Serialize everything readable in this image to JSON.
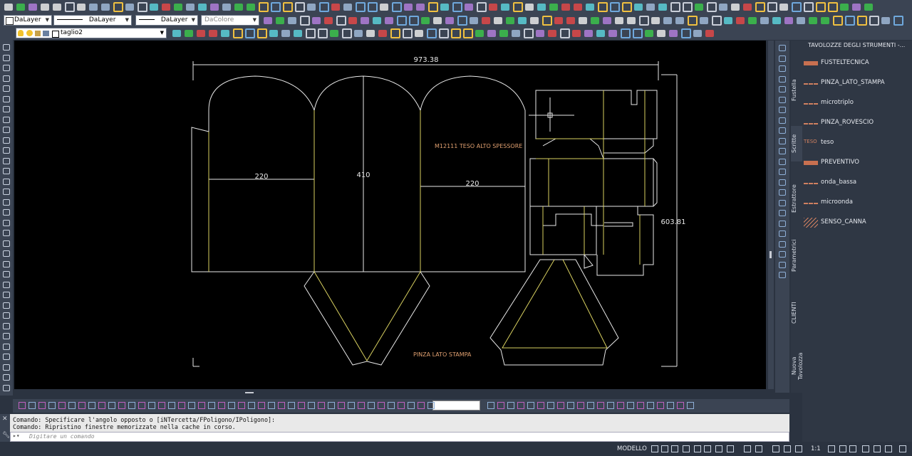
{
  "toolbar": {
    "layer_select": "DaLayer",
    "linetype_select": "DaLayer",
    "lineweight_select": "DaLayer",
    "color_select": "DaColore",
    "current_layer": "taglio2"
  },
  "drawing": {
    "dim_width": "973.38",
    "dim_height": "603.81",
    "dim_left_panel": "220",
    "dim_center_panel": "410",
    "dim_right_panel": "220",
    "label_article": "M12111 TESO ALTO SPESSORE",
    "label_pinza": "PINZA LATO STAMPA"
  },
  "palette": {
    "title": "TAVOLOZZE DEGLI STRUMENTI -...",
    "items": [
      {
        "label": "FUSTELTECNICA",
        "icon": "fustella-swatch-icon"
      },
      {
        "label": "PINZA_LATO_STAMPA",
        "icon": "dashed-line-icon"
      },
      {
        "label": "microtriplo",
        "icon": "dashed-line-icon"
      },
      {
        "label": "PINZA_ROVESCIO",
        "icon": "dashed-line-icon"
      },
      {
        "label": "teso",
        "icon": "teso-text-icon"
      },
      {
        "label": "PREVENTIVO",
        "icon": "preventivo-swatch-icon"
      },
      {
        "label": "onda_bassa",
        "icon": "dashed-line-icon"
      },
      {
        "label": "microonda",
        "icon": "dashed-line-icon"
      },
      {
        "label": "SENSO_CANNA",
        "icon": "diagonal-hatch-icon"
      }
    ]
  },
  "side_tabs": [
    "Fustella",
    "Scritte",
    "Estrattore",
    "Parametrici",
    "CLIENTI",
    "Nuova Tavolozza"
  ],
  "command": {
    "line1": "Comando: Specificare l'angolo opposto o [iNTercetta/FPoligono/IPoligono]:",
    "line2": "Comando: Ripristino finestre memorizzate nella cache in corso.",
    "placeholder": "Digitare un comando"
  },
  "status": {
    "space": "MODELLO",
    "scale": "1:1"
  },
  "colors": {
    "canvas": "#000000",
    "geometry": "#e8e8e8",
    "crease": "#d8d060",
    "text_orange": "#e0a070",
    "ui_dark": "#2b3340"
  }
}
